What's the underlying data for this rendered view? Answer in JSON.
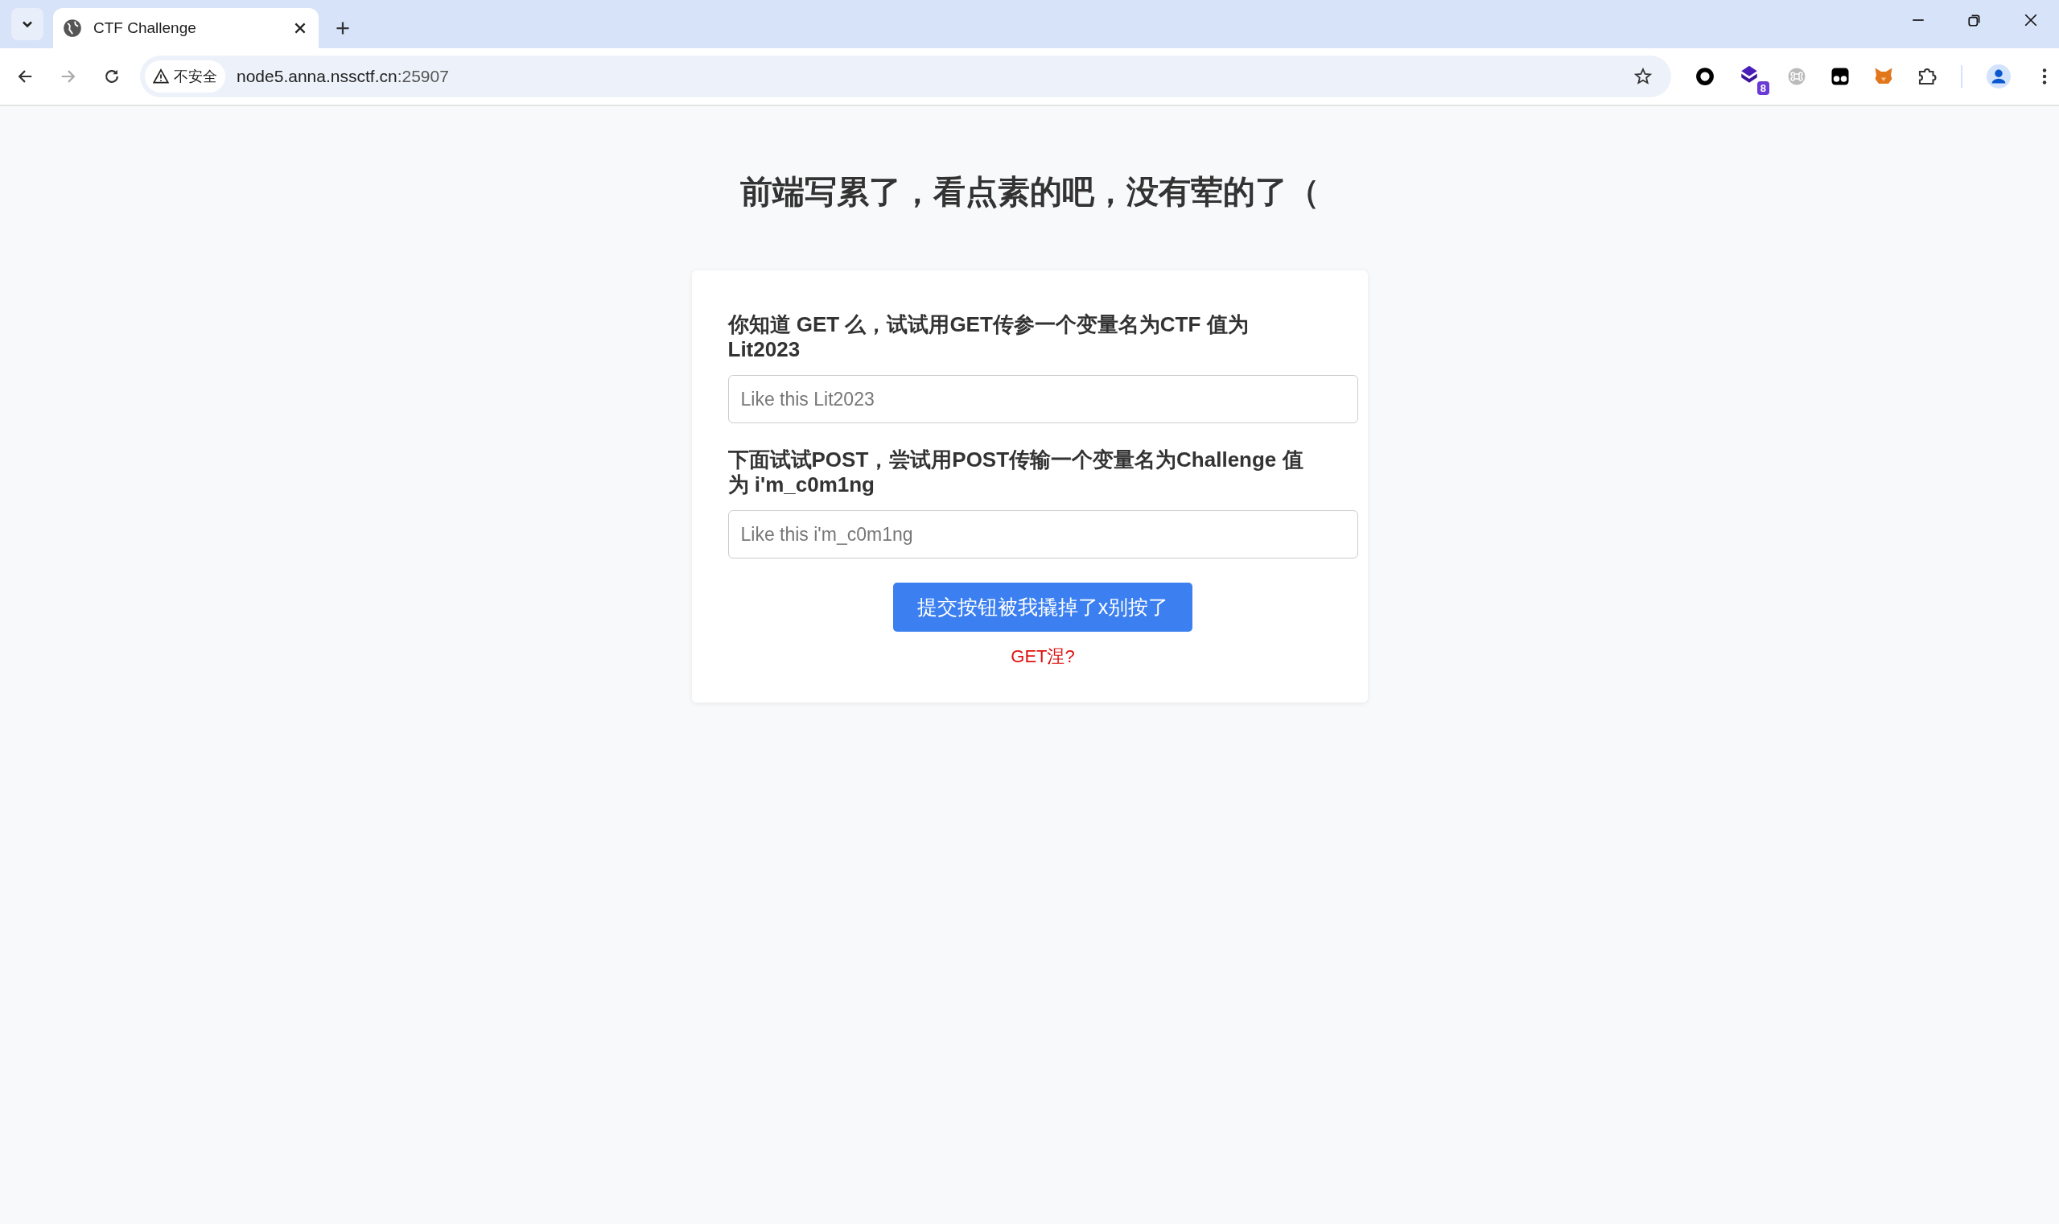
{
  "browser": {
    "tab": {
      "title": "CTF Challenge",
      "selected": true
    },
    "address": {
      "security_label": "不安全",
      "host": "node5.anna.nssctf.cn",
      "port": ":25907"
    },
    "extension_badge": "8"
  },
  "page": {
    "heading": "前端写累了，看点素的吧，没有荤的了（",
    "fields": [
      {
        "label": "你知道 GET 么，试试用GET传参一个变量名为CTF 值为 Lit2023",
        "placeholder": "Like this Lit2023"
      },
      {
        "label": "下面试试POST，尝试用POST传输一个变量名为Challenge 值为 i'm_c0m1ng",
        "placeholder": "Like this i'm_c0m1ng"
      }
    ],
    "submit_button": "提交按钮被我撬掉了x别按了",
    "link": "GET涅?"
  }
}
